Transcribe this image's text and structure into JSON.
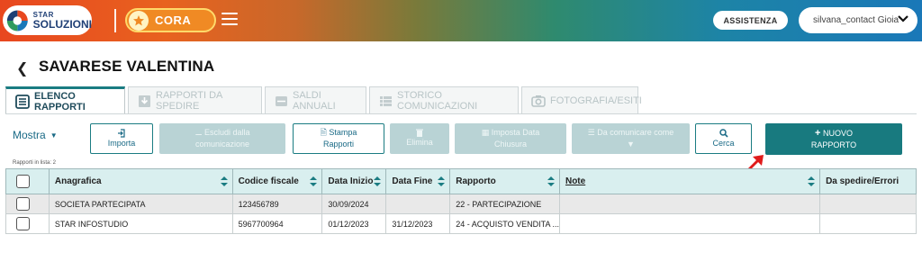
{
  "header": {
    "logo_line1": "STAR",
    "logo_line2": "SOLUZIONI",
    "app_switch_label": "CORA",
    "assist_label": "ASSISTENZA",
    "user_label": "silvana_contact Gioia",
    "colors": {
      "brand_start": "#e8471f",
      "brand_end": "#1a78b8",
      "accent": "#f08a24"
    }
  },
  "page": {
    "title": "SAVARESE VALENTINA"
  },
  "tabs": [
    {
      "label": "ELENCO RAPPORTI",
      "icon": "list-icon",
      "active": true
    },
    {
      "label": "RAPPORTI DA SPEDIRE",
      "icon": "download-box-icon",
      "active": false
    },
    {
      "label": "SALDI ANNUALI",
      "icon": "wallet-icon",
      "active": false
    },
    {
      "label": "STORICO COMUNICAZIONI",
      "icon": "table-list-icon",
      "active": false
    },
    {
      "label": "FOTOGRAFIA/ESITI",
      "icon": "camera-icon",
      "active": false
    }
  ],
  "toolbar": {
    "mostra_label": "Mostra",
    "importa_label": "Importa",
    "escludi_line1": "Escludi dalla",
    "escludi_line2": "comunicazione",
    "stampa_line1": "Stampa",
    "stampa_line2": "Rapporti",
    "elimina_label": "Elimina",
    "imposta_line1": "Imposta Data",
    "imposta_line2": "Chiusura",
    "comunicare_label": "Da comunicare come",
    "cerca_label": "Cerca",
    "nuovo_line1": "NUOVO",
    "nuovo_line2": "RAPPORTO",
    "primary_color": "#187a7f"
  },
  "list_info": "Rapporti in lista: 2",
  "table": {
    "headers": [
      "Anagrafica",
      "Codice fiscale",
      "Data Inizio",
      "Data Fine",
      "Rapporto",
      "Note",
      "Da spedire/Errori"
    ],
    "rows": [
      [
        "SOCIETA PARTECIPATA",
        "123456789",
        "30/09/2024",
        "",
        "22 - PARTECIPAZIONE",
        "",
        ""
      ],
      [
        "STAR INFOSTUDIO",
        "5967700964",
        "01/12/2023",
        "31/12/2023",
        "24 - ACQUISTO VENDITA ...",
        "",
        ""
      ]
    ]
  }
}
